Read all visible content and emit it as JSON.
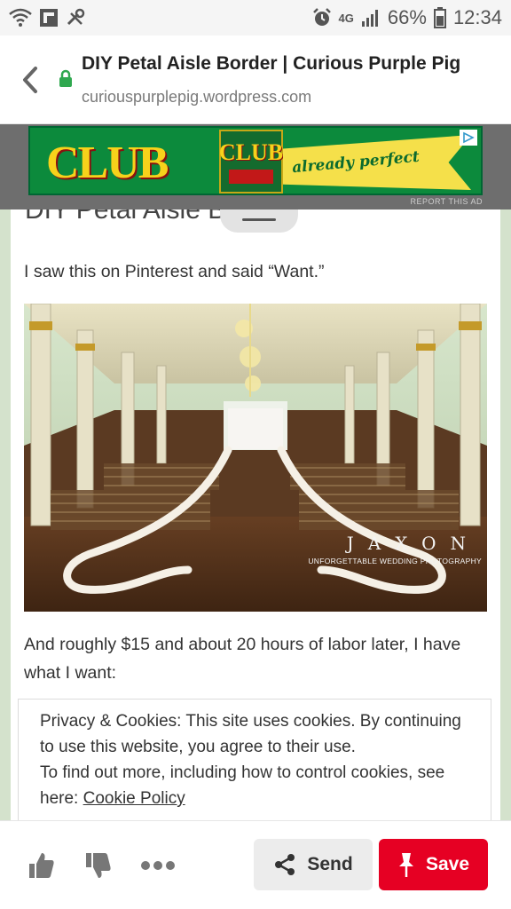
{
  "status_bar": {
    "network": "4G",
    "battery": "66%",
    "time": "12:34"
  },
  "header": {
    "title": "DIY Petal Aisle Border | Curious Purple Pig",
    "url": "curiouspurplepig.wordpress.com"
  },
  "ad": {
    "brand": "CLUB",
    "pack_brand": "CLUB",
    "tagline": "already perfect",
    "report_label": "REPORT THIS AD"
  },
  "article": {
    "title_partial": "DIY Petal Aisle B",
    "para1": "I saw this on Pinterest and said “Want.”",
    "photo_watermark": "JAXON",
    "photo_watermark_sub": "UNFORGETTABLE WEDDING PHOTOGRAPHY",
    "para2": "And roughly $15 and about 20 hours of labor later, I have what I want:"
  },
  "cookie": {
    "text1": "Privacy & Cookies: This site uses cookies. By continuing to use this website, you agree to their use.",
    "text2": "To find out more, including how to control cookies, see here: ",
    "link": "Cookie Policy"
  },
  "toolbar": {
    "send_label": "Send",
    "save_label": "Save"
  }
}
